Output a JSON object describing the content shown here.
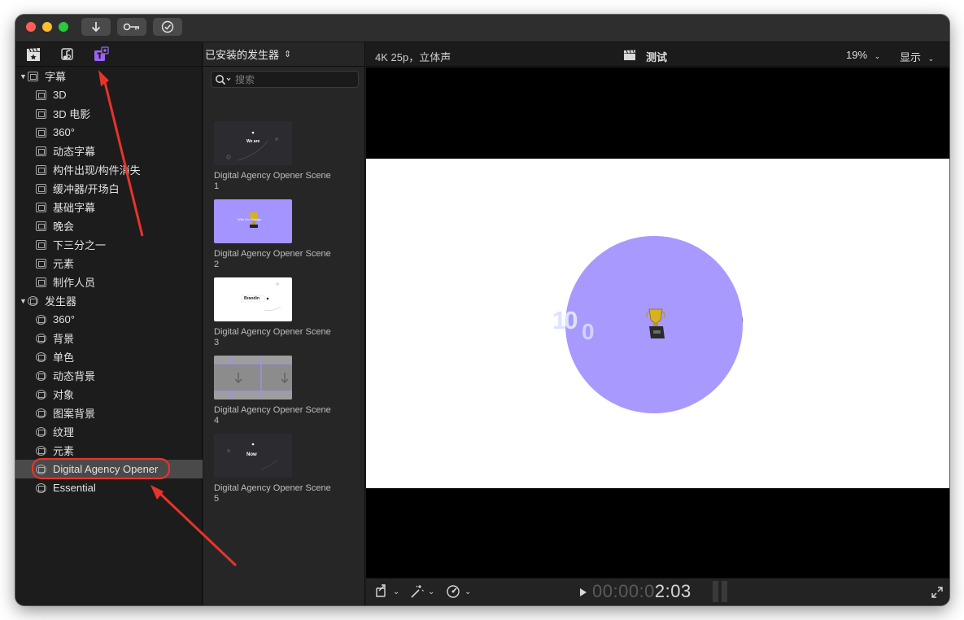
{
  "sidebar": {
    "titles_group": "字幕",
    "titles_items": [
      "3D",
      "3D 电影",
      "360°",
      "动态字幕",
      "构件出现/构件消失",
      "缓冲器/开场白",
      "基础字幕",
      "晚会",
      "下三分之一",
      "元素",
      "制作人员"
    ],
    "generators_group": "发生器",
    "generators_items": [
      "360°",
      "背景",
      "单色",
      "动态背景",
      "对象",
      "图案背景",
      "纹理",
      "元素",
      "Digital Agency Opener",
      "Essential"
    ]
  },
  "browser": {
    "header": "已安装的发生器",
    "search_placeholder": "搜索",
    "clips": [
      {
        "label": "Digital Agency Opener Scene 1",
        "thumb_text": "We are"
      },
      {
        "label": "Digital Agency Opener Scene 2",
        "thumb_text": "With Our Design"
      },
      {
        "label": "Digital Agency Opener Scene 3",
        "thumb_text": "Brandin"
      },
      {
        "label": "Digital Agency Opener Scene 4",
        "thumb_text": ""
      },
      {
        "label": "Digital Agency Opener Scene 5",
        "thumb_text": "Now"
      }
    ]
  },
  "viewer": {
    "format": "4K 25p，立体声",
    "project": "测试",
    "zoom": "19%",
    "display_menu": "显示",
    "frame_text_1": "10",
    "frame_text_2": "0",
    "timecode_dim": "00:00:0",
    "timecode_lit": "2:03"
  },
  "colors": {
    "accent_purple": "#9b63f5",
    "circle_fill": "#a899ff",
    "selection_bg": "#4a4a4a",
    "annotation_red": "#e8332a"
  },
  "icons": [
    "down-arrow-icon",
    "key-icon",
    "checkmark-circle-icon",
    "clapper-icon",
    "music-note-icon",
    "titles-generators-icon",
    "magnifier-icon",
    "transform-icon",
    "magic-wand-icon",
    "speedometer-icon",
    "play-icon",
    "fullscreen-icon"
  ]
}
